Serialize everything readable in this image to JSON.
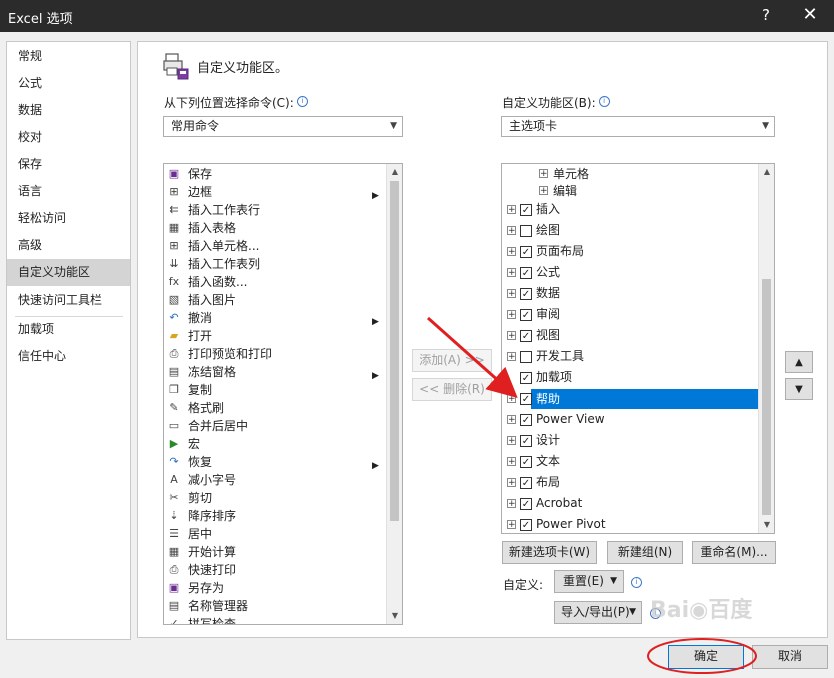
{
  "window": {
    "title": "Excel 选项",
    "help": "?",
    "close": "✕"
  },
  "nav": {
    "items": [
      "常规",
      "公式",
      "数据",
      "校对",
      "保存",
      "语言",
      "轻松访问",
      "高级",
      "自定义功能区",
      "快速访问工具栏",
      "加载项",
      "信任中心"
    ],
    "selected": "自定义功能区"
  },
  "header": {
    "title": "自定义功能区。"
  },
  "left": {
    "label": "从下列位置选择命令(C):",
    "dropdown_value": "常用命令",
    "commands": [
      {
        "label": "保存",
        "icon": "save-icon",
        "glyph": "▣"
      },
      {
        "label": "边框",
        "icon": "border-icon",
        "glyph": "⊞",
        "sub": true
      },
      {
        "label": "插入工作表行",
        "icon": "insert-row-icon",
        "glyph": "⇇"
      },
      {
        "label": "插入表格",
        "icon": "insert-table-icon",
        "glyph": "▦"
      },
      {
        "label": "插入单元格...",
        "icon": "insert-cells-icon",
        "glyph": "⊞"
      },
      {
        "label": "插入工作表列",
        "icon": "insert-column-icon",
        "glyph": "⇊"
      },
      {
        "label": "插入函数...",
        "icon": "function-icon",
        "glyph": "fx"
      },
      {
        "label": "插入图片",
        "icon": "picture-icon",
        "glyph": "▧"
      },
      {
        "label": "撤消",
        "icon": "undo-icon",
        "glyph": "↶",
        "sub": true
      },
      {
        "label": "打开",
        "icon": "folder-icon",
        "glyph": "▰"
      },
      {
        "label": "打印预览和打印",
        "icon": "print-preview-icon",
        "glyph": "⎙"
      },
      {
        "label": "冻结窗格",
        "icon": "freeze-panes-icon",
        "glyph": "▤",
        "sub": true
      },
      {
        "label": "复制",
        "icon": "copy-icon",
        "glyph": "❐"
      },
      {
        "label": "格式刷",
        "icon": "format-painter-icon",
        "glyph": "✎"
      },
      {
        "label": "合并后居中",
        "icon": "merge-center-icon",
        "glyph": "▭"
      },
      {
        "label": "宏",
        "icon": "macro-icon",
        "glyph": "▶"
      },
      {
        "label": "恢复",
        "icon": "redo-icon",
        "glyph": "↷",
        "sub": true
      },
      {
        "label": "减小字号",
        "icon": "decrease-font-icon",
        "glyph": "A"
      },
      {
        "label": "剪切",
        "icon": "cut-icon",
        "glyph": "✂"
      },
      {
        "label": "降序排序",
        "icon": "sort-desc-icon",
        "glyph": "⇣"
      },
      {
        "label": "居中",
        "icon": "center-align-icon",
        "glyph": "☰"
      },
      {
        "label": "开始计算",
        "icon": "calculator-icon",
        "glyph": "▦"
      },
      {
        "label": "快速打印",
        "icon": "quick-print-icon",
        "glyph": "⎙"
      },
      {
        "label": "另存为",
        "icon": "save-as-icon",
        "glyph": "▣"
      },
      {
        "label": "名称管理器",
        "icon": "name-manager-icon",
        "glyph": "▤"
      },
      {
        "label": "拼写检查",
        "icon": "spelling-icon",
        "glyph": "✓"
      }
    ]
  },
  "middle": {
    "add_label": "添加(A) >>",
    "remove_label": "<< 删除(R)"
  },
  "right": {
    "label": "自定义功能区(B):",
    "dropdown_value": "主选项卡",
    "tree": [
      {
        "label": "单元格",
        "level": 2,
        "checkbox": false,
        "checked": false
      },
      {
        "label": "编辑",
        "level": 2,
        "checkbox": false,
        "checked": false
      },
      {
        "label": "插入",
        "level": 1,
        "checkbox": true,
        "checked": true
      },
      {
        "label": "绘图",
        "level": 1,
        "checkbox": true,
        "checked": false
      },
      {
        "label": "页面布局",
        "level": 1,
        "checkbox": true,
        "checked": true
      },
      {
        "label": "公式",
        "level": 1,
        "checkbox": true,
        "checked": true
      },
      {
        "label": "数据",
        "level": 1,
        "checkbox": true,
        "checked": true
      },
      {
        "label": "审阅",
        "level": 1,
        "checkbox": true,
        "checked": true
      },
      {
        "label": "视图",
        "level": 1,
        "checkbox": true,
        "checked": true
      },
      {
        "label": "开发工具",
        "level": 1,
        "checkbox": true,
        "checked": false
      },
      {
        "label": "加载项",
        "level": 1,
        "checkbox": true,
        "checked": true,
        "noexp": true
      },
      {
        "label": "帮助",
        "level": 1,
        "checkbox": true,
        "checked": true,
        "selected": true
      },
      {
        "label": "Power View",
        "level": 1,
        "checkbox": true,
        "checked": true
      },
      {
        "label": "设计",
        "level": 1,
        "checkbox": true,
        "checked": true
      },
      {
        "label": "文本",
        "level": 1,
        "checkbox": true,
        "checked": true
      },
      {
        "label": "布局",
        "level": 1,
        "checkbox": true,
        "checked": true
      },
      {
        "label": "Acrobat",
        "level": 1,
        "checkbox": true,
        "checked": true
      },
      {
        "label": "Power Pivot",
        "level": 1,
        "checkbox": true,
        "checked": true
      }
    ],
    "new_tab_label": "新建选项卡(W)",
    "new_group_label": "新建组(N)",
    "rename_label": "重命名(M)...",
    "customize_label": "自定义:",
    "reset_label": "重置(E)",
    "import_export_label": "导入/导出(P)",
    "move_up": "▲",
    "move_down": "▼"
  },
  "footer": {
    "ok_label": "确定",
    "cancel_label": "取消"
  },
  "colors": {
    "selection": "#0078d7",
    "annotation": "#e02020",
    "titlebar": "#2b2b2b"
  }
}
